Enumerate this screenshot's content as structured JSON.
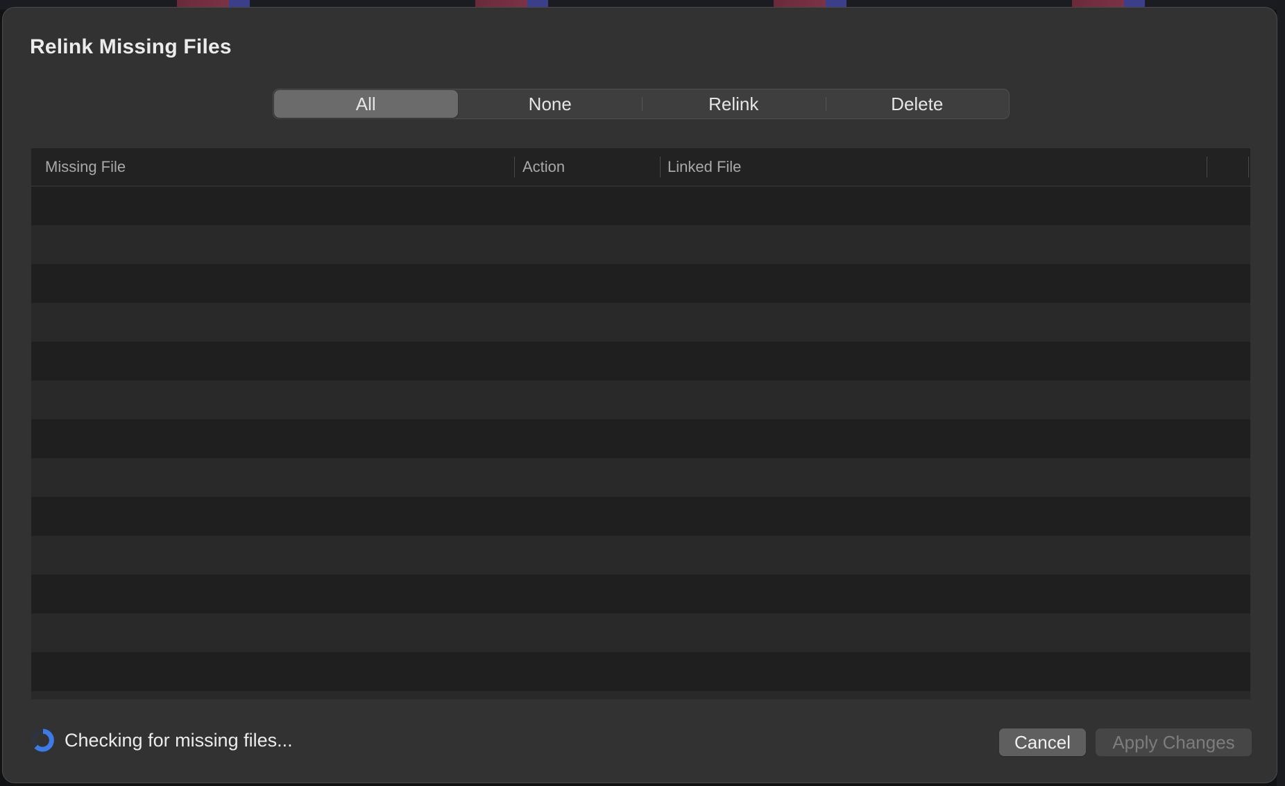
{
  "dialog": {
    "title": "Relink Missing Files"
  },
  "segmented_control": {
    "options": [
      "All",
      "None",
      "Relink",
      "Delete"
    ],
    "selected": "All"
  },
  "table": {
    "columns": [
      "Missing File",
      "Action",
      "Linked File"
    ],
    "rows": []
  },
  "status": {
    "text": "Checking for missing files...",
    "icon": "spinner-icon"
  },
  "buttons": {
    "cancel": "Cancel",
    "apply": "Apply Changes",
    "apply_enabled": false
  }
}
